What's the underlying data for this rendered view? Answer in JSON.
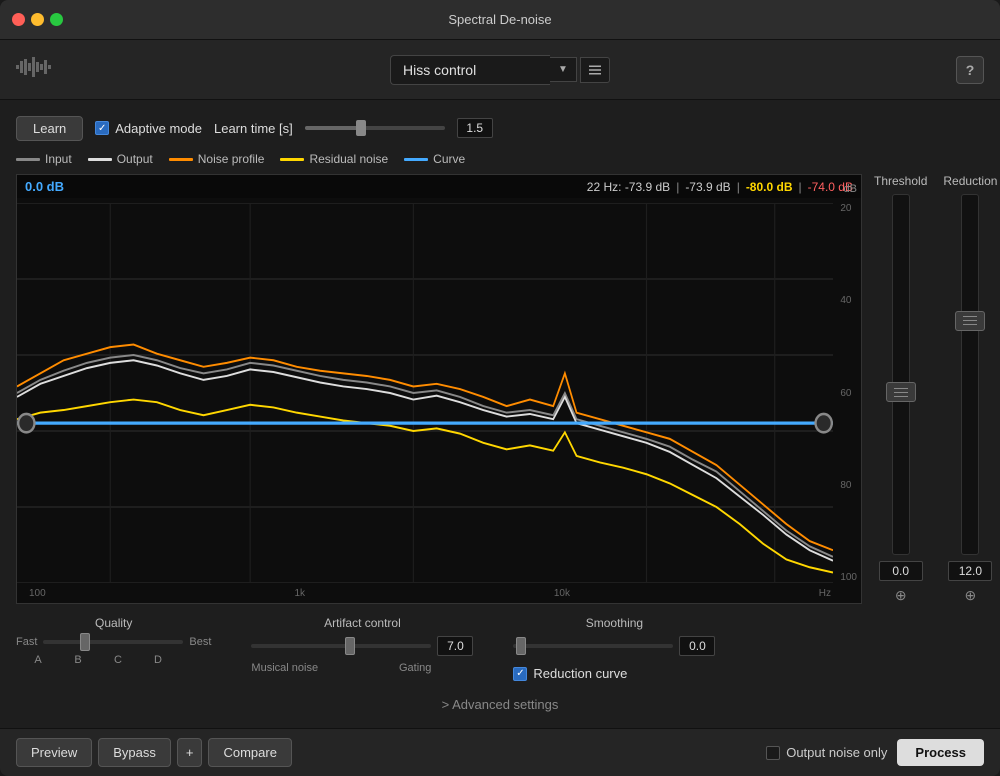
{
  "window": {
    "title": "Spectral De-noise"
  },
  "toolbar": {
    "preset_name": "Hiss control",
    "help_label": "?"
  },
  "controls": {
    "learn_label": "Learn",
    "adaptive_mode_label": "Adaptive mode",
    "adaptive_checked": true,
    "learn_time_label": "Learn time [s]",
    "learn_time_value": "1.5",
    "learn_time_slider_pct": 40
  },
  "legend": {
    "input_label": "Input",
    "output_label": "Output",
    "noise_profile_label": "Noise profile",
    "residual_noise_label": "Residual noise",
    "curve_label": "Curve",
    "input_color": "#888",
    "output_color": "#ccc",
    "noise_profile_color": "#ff8c00",
    "residual_noise_color": "#ffd700",
    "curve_color": "#4af"
  },
  "chart": {
    "db_value": "0.0 dB",
    "freq_label": "22 Hz: -73.9 dB",
    "val_white": "-73.9 dB",
    "val_orange": "-80.0 dB",
    "val_yellow": "-74.0 dB",
    "dB_unit": "dB",
    "db_labels": [
      "20",
      "40",
      "60",
      "80",
      "100"
    ],
    "hz_labels": [
      "100",
      "1k",
      "10k",
      "Hz"
    ],
    "threshold_pct": 58
  },
  "threshold_slider": {
    "label": "Threshold",
    "value": "0.0",
    "thumb_pct": 55
  },
  "reduction_slider": {
    "label": "Reduction",
    "value": "12.0",
    "thumb_pct": 35
  },
  "quality": {
    "title": "Quality",
    "fast_label": "Fast",
    "best_label": "Best",
    "thumb_pct": 30,
    "ticks": [
      "A",
      "B",
      "C",
      "D"
    ]
  },
  "artifact": {
    "title": "Artifact control",
    "value": "7.0",
    "thumb_pct": 55,
    "label_left": "Musical noise",
    "label_right": "Gating"
  },
  "smoothing": {
    "title": "Smoothing",
    "value": "0.0",
    "thumb_pct": 5,
    "reduction_curve_label": "Reduction curve",
    "reduction_curve_checked": true
  },
  "advanced": {
    "label": "> Advanced settings"
  },
  "footer": {
    "preview_label": "Preview",
    "bypass_label": "Bypass",
    "plus_label": "+",
    "compare_label": "Compare",
    "output_noise_label": "Output noise only",
    "process_label": "Process"
  }
}
